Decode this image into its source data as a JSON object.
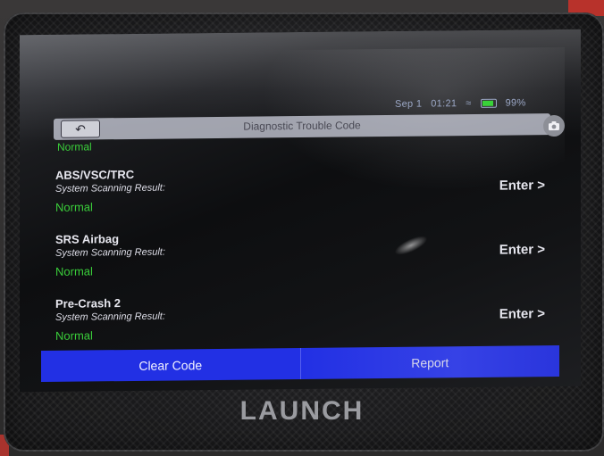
{
  "status_bar": {
    "date": "Sep 1",
    "time": "01:21",
    "battery": "99%"
  },
  "header": {
    "title": "Diagnostic Trouble Code"
  },
  "partial_row": {
    "status": "Normal"
  },
  "systems": [
    {
      "name": "ABS/VSC/TRC",
      "subtitle": "System Scanning Result:",
      "status": "Normal",
      "action": "Enter >"
    },
    {
      "name": "SRS Airbag",
      "subtitle": "System Scanning Result:",
      "status": "Normal",
      "action": "Enter >"
    },
    {
      "name": "Pre-Crash 2",
      "subtitle": "System Scanning Result:",
      "status": "Normal",
      "action": "Enter >"
    }
  ],
  "footer": {
    "clear_code": "Clear Code",
    "report": "Report"
  },
  "device": {
    "brand": "LAUNCH"
  },
  "colors": {
    "status_normal": "#3acd3a",
    "button_blue": "#2230e4"
  }
}
